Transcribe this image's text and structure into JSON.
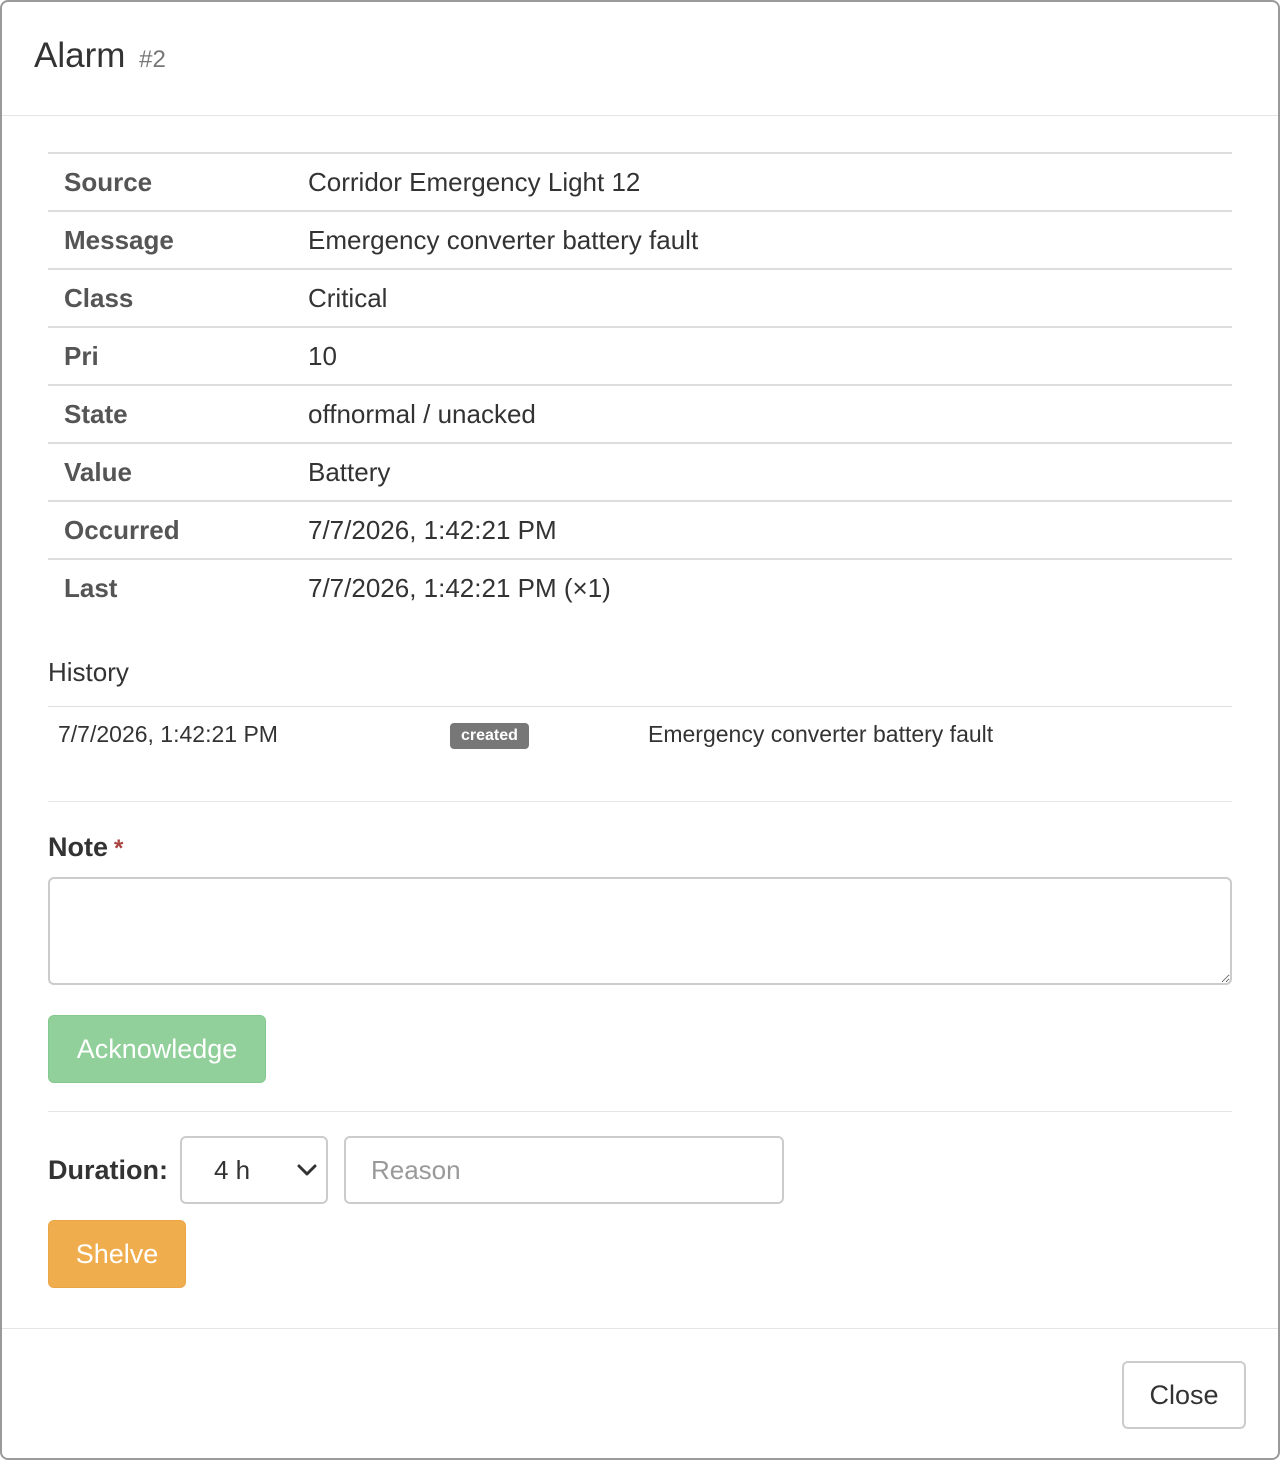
{
  "modal": {
    "title": "Alarm",
    "id_label": "#2"
  },
  "details": [
    {
      "key": "Source",
      "value": "Corridor Emergency Light 12"
    },
    {
      "key": "Message",
      "value": "Emergency converter battery fault"
    },
    {
      "key": "Class",
      "value": "Critical"
    },
    {
      "key": "Pri",
      "value": "10"
    },
    {
      "key": "State",
      "value": "offnormal / unacked"
    },
    {
      "key": "Value",
      "value": "Battery"
    },
    {
      "key": "Occurred",
      "value": "7/7/2026, 1:42:21 PM"
    },
    {
      "key": "Last",
      "value": "7/7/2026, 1:42:21 PM (×1)"
    }
  ],
  "history": {
    "title": "History",
    "entries": [
      {
        "time": "7/7/2026, 1:42:21 PM",
        "badge": "created",
        "message": "Emergency converter battery fault"
      }
    ]
  },
  "note": {
    "label": "Note",
    "required_mark": "*",
    "value": "",
    "acknowledge_label": "Acknowledge"
  },
  "shelve": {
    "duration_label": "Duration:",
    "duration_value": "4 h",
    "reason_placeholder": "Reason",
    "reason_value": "",
    "shelve_label": "Shelve"
  },
  "footer": {
    "close_label": "Close"
  },
  "colors": {
    "acknowledge": "#92d09b",
    "shelve": "#efad4e",
    "badge": "#777777",
    "required": "#a94442"
  }
}
